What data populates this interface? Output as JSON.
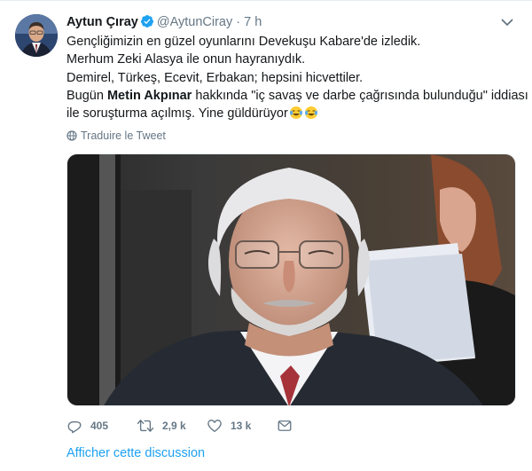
{
  "tweet": {
    "author_name": "Aytun Çıray",
    "handle": "@AytunCiray",
    "separator": "·",
    "time": "7 h",
    "lines": [
      "Gençliğimizin en güzel oyunlarını Devekuşu Kabare'de izledik.",
      "Merhum Zeki Alasya ile onun hayranıydık.",
      "Demirel, Türkeş, Ecevit, Erbakan; hepsini hicvettiler."
    ],
    "line4_before": "Bugün ",
    "line4_bold": "Metin Akpınar",
    "line4_after": " hakkında \"iç savaş ve darbe çağrısında bulunduğu\" iddiası",
    "line5": "ile soruşturma açılmış. Yine güldürüyor",
    "translate_label": "Traduire le Tweet"
  },
  "actions": {
    "replies": "405",
    "retweets": "2,9 k",
    "likes": "13 k"
  },
  "discussion_link": "Afficher cette discussion",
  "colors": {
    "link_blue": "#1da1f2",
    "secondary_gray": "#657786",
    "text": "#14171a"
  }
}
